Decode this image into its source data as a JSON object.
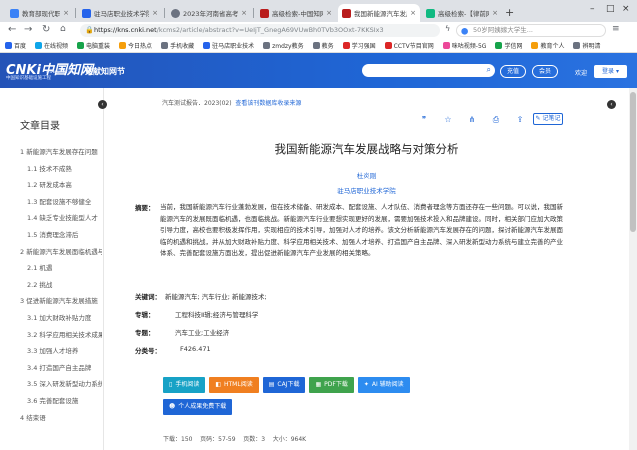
{
  "browser": {
    "tabs": [
      {
        "title": "教育部现代职业教育",
        "color": "#3b82f6"
      },
      {
        "title": "驻马店职业技术学院",
        "color": "#2563eb"
      },
      {
        "title": "2023年河南省高考",
        "color": "#6b7280"
      },
      {
        "title": "高级检索-中国知网",
        "color": "#b91c1c"
      },
      {
        "title": "我国新能源汽车发展",
        "color": "#b91c1c"
      },
      {
        "title": "高级检索-【律前网】",
        "color": "#10b981"
      }
    ],
    "url_host": "https://kns.cnki.net",
    "url_path": "/kcms2/article/abstract?v=UeIjT_GnegA69VUwBh0TVb3OOxt-7KKSIx3",
    "search_engine_text": "50岁阿姨嫁大学生...",
    "bookmarks": [
      {
        "label": "百度",
        "color": "#2563eb"
      },
      {
        "label": "在线视频",
        "color": "#0ea5e9"
      },
      {
        "label": "电脑重装",
        "color": "#16a34a"
      },
      {
        "label": "今日热点",
        "color": "#f59e0b"
      },
      {
        "label": "手机收藏",
        "color": "#6b7280"
      },
      {
        "label": "驻马店职业技术",
        "color": "#2563eb"
      },
      {
        "label": "zmdzy教务",
        "color": "#6b7280"
      },
      {
        "label": "教务",
        "color": "#6b7280"
      },
      {
        "label": "学习强国",
        "color": "#dc2626"
      },
      {
        "label": "CCTV节目官网",
        "color": "#dc2626"
      },
      {
        "label": "咪咕视频-5G",
        "color": "#ec4899"
      },
      {
        "label": "学信网",
        "color": "#16a34a"
      },
      {
        "label": "教育个人",
        "color": "#f59e0b"
      },
      {
        "label": "辨明清",
        "color": "#6b7280"
      }
    ]
  },
  "cnki": {
    "logo": "CNKi中国知网",
    "logo_url": "www.cnki.net",
    "logo_sub": "中国知识基础设施工程",
    "brand": "文献知网节",
    "btn_charge": "充值",
    "btn_member": "会员",
    "welcome": "欢迎",
    "login": "登录"
  },
  "toc": {
    "title": "文章目录",
    "items": [
      {
        "label": "1 新能源汽车发展存在问题",
        "level": 1
      },
      {
        "label": "1.1 技术不成熟",
        "level": 2
      },
      {
        "label": "1.2 研发成本高",
        "level": 2
      },
      {
        "label": "1.3 配套设施不够健全",
        "level": 2
      },
      {
        "label": "1.4 缺乏专业技能型人才",
        "level": 2
      },
      {
        "label": "1.5 消费理念滞后",
        "level": 2
      },
      {
        "label": "2 新能源汽车发展面临机遇与挑战",
        "level": 1
      },
      {
        "label": "2.1 机遇",
        "level": 2
      },
      {
        "label": "2.2 挑战",
        "level": 2
      },
      {
        "label": "3 促进新能源汽车发展措施",
        "level": 1
      },
      {
        "label": "3.1 加大财政补贴力度",
        "level": 2
      },
      {
        "label": "3.2 科学应用相关技术成果",
        "level": 2
      },
      {
        "label": "3.3 加强人才培养",
        "level": 2
      },
      {
        "label": "3.4 打造国产自主品牌",
        "level": 2
      },
      {
        "label": "3.5 深入研发新型动力系统",
        "level": 2
      },
      {
        "label": "3.6 完善配套设施",
        "level": 2
      },
      {
        "label": "4 结束语",
        "level": 1
      }
    ]
  },
  "article": {
    "source": "汽车测试报告．2023(02)",
    "link1": "查看该刊数据库收录来源",
    "link2": "",
    "note_button": "记笔记",
    "title": "我国新能源汽车发展战略与对策分析",
    "author": "杜炎刚",
    "org": "驻马店职业技术学院",
    "abstract_label": "摘要：",
    "abstract": "当前，我国新能源汽车行业蓬勃发展，但在技术储备、研发成本、配套设施、人才队伍、消费者理念等方面还存在一些问题。可以说，我国新能源汽车的发展既面临机遇，也面临挑战。新能源汽车行业要想实现更好的发展，需要加强技术投入和品牌建设。同时，相关部门应加大政策引导力度，高校也要积极发挥作用，实现相应的技术引导，加强对人才的培养。该文分析新能源汽车发展存在的问题，探讨新能源汽车发展面临的机遇和挑战，并从加大财政补贴力度、科学应用相关技术、加强人才培养、打造国产自主品牌、深入研发新型动力系统与建立完善的产业体系、完善配套设施方面出发，提出促进新能源汽车产业发展的相关策略。",
    "keywords_label": "关键词：",
    "keywords": "新能源汽车;  汽车行业;  新能源技术;",
    "topic_label": "专辑：",
    "topic": "工程科技Ⅱ辑;经济与管理科学",
    "subject_label": "专题：",
    "subject": "汽车工业;工业经济",
    "class_label": "分类号：",
    "class": "F426.471"
  },
  "downloads": [
    {
      "label": "手机阅读",
      "icon": "phone-icon",
      "color": "#17a2c6"
    },
    {
      "label": "HTML阅读",
      "icon": "html-icon",
      "color": "#f07f20"
    },
    {
      "label": "CAJ下载",
      "icon": "caj-icon",
      "color": "#1f66d6"
    },
    {
      "label": "PDF下载",
      "icon": "pdf-icon",
      "color": "#3fa34d"
    },
    {
      "label": "AI 辅助阅读",
      "icon": "ai-icon",
      "color": "#2d8cf0"
    },
    {
      "label": "个人成果免费下载",
      "icon": "user-icon",
      "color": "#1f66d6"
    }
  ],
  "stats": {
    "downloads_label": "下载：",
    "downloads": "150",
    "pages_label": "页码：",
    "pages": "57-59",
    "page_count_label": "页数：",
    "page_count": "3",
    "size_label": "大小：",
    "size": "964K"
  }
}
